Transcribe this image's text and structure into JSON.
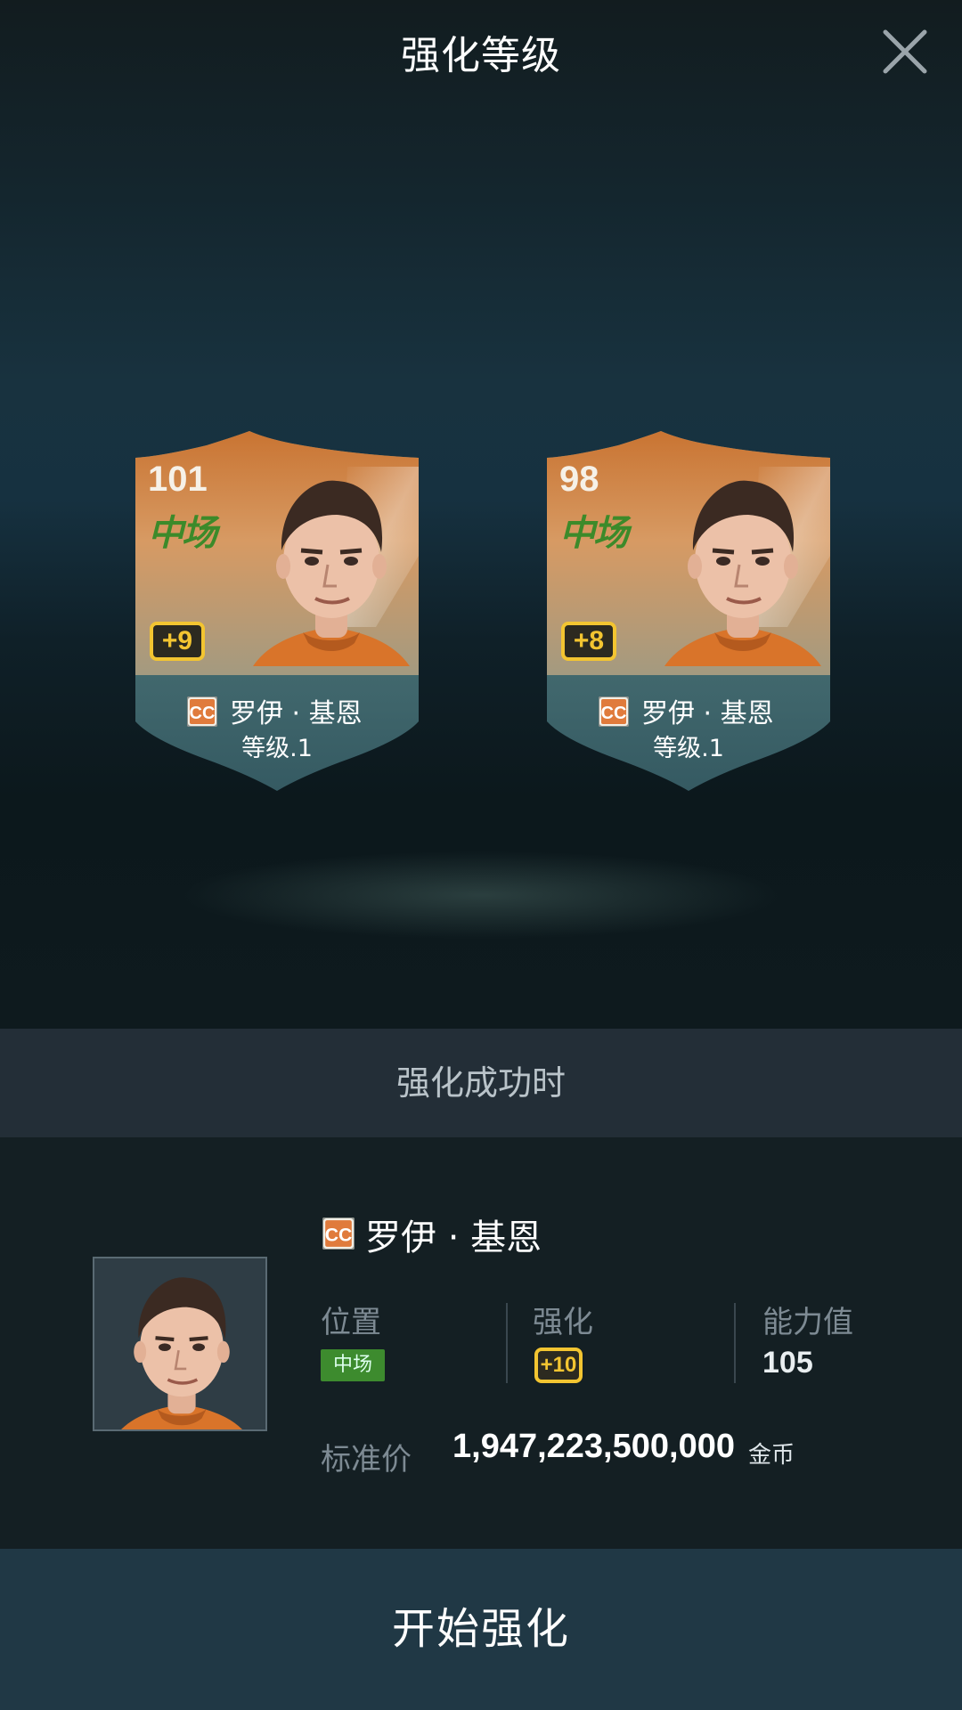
{
  "header": {
    "title": "强化等级",
    "close_icon": "close-icon"
  },
  "cards": [
    {
      "rating": "101",
      "position": "中场",
      "plus": "+9",
      "name": "罗伊 · 基恩",
      "level": "等级.1"
    },
    {
      "rating": "98",
      "position": "中场",
      "plus": "+8",
      "name": "罗伊 · 基恩",
      "level": "等级.1"
    }
  ],
  "section": {
    "title": "强化成功时"
  },
  "result": {
    "name": "罗伊 · 基恩",
    "position_label": "位置",
    "position_value": "中场",
    "enhance_label": "强化",
    "enhance_value": "+10",
    "ability_label": "能力值",
    "ability_value": "105",
    "price_label": "标准价",
    "price_value": "1,947,223,500,000",
    "price_unit": "金币"
  },
  "action": {
    "start_label": "开始强化"
  },
  "colors": {
    "accent_gold": "#f3c531",
    "position_green": "#3d8b2e",
    "card_orange": "#c8782e",
    "card_teal": "#3f6a6e"
  }
}
